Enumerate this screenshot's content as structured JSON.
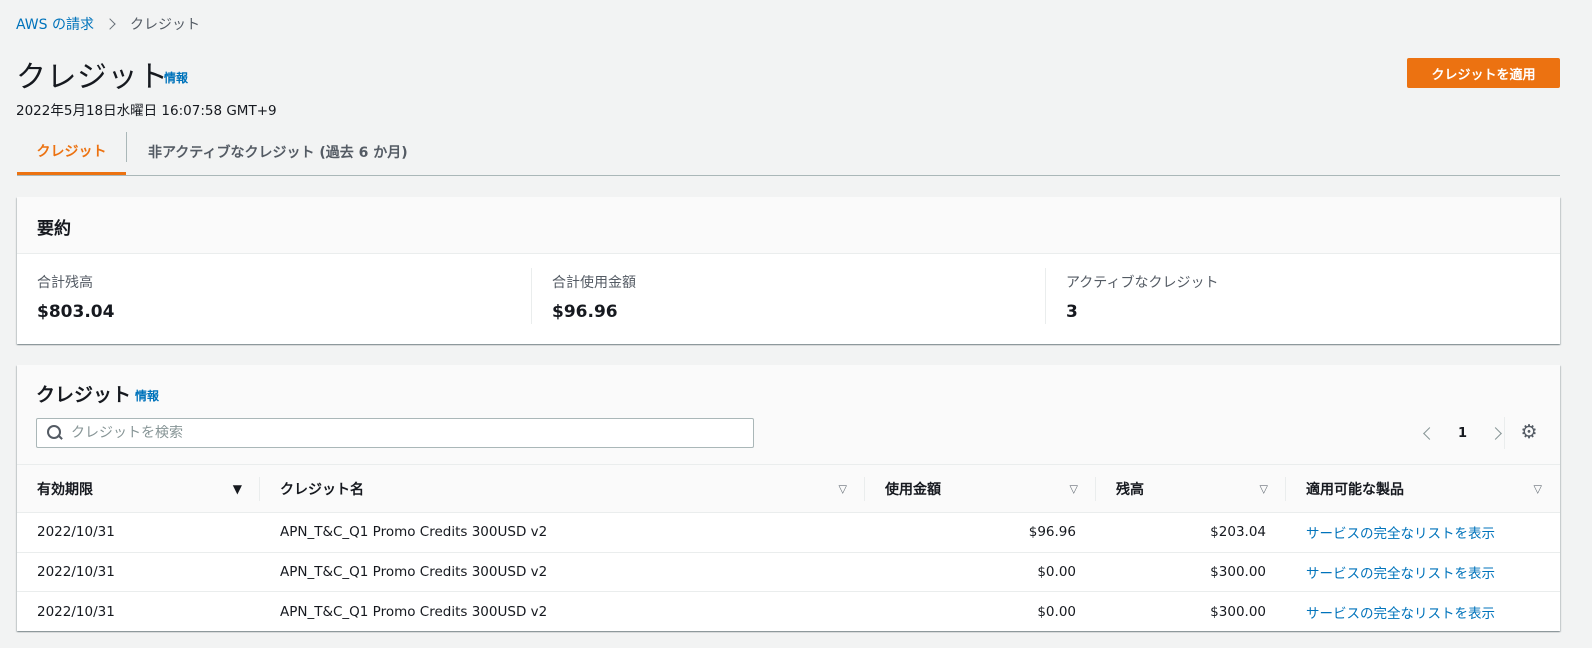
{
  "breadcrumb": {
    "parent": "AWS の請求",
    "current": "クレジット"
  },
  "page": {
    "title": "クレジット",
    "info_label": "情報",
    "timestamp": "2022年5月18日水曜日 16:07:58 GMT+9",
    "apply_button_label": "クレジットを適用"
  },
  "tabs": [
    {
      "label": "クレジット",
      "active": true
    },
    {
      "label": "非アクティブなクレジット (過去 6 か月)",
      "active": false
    }
  ],
  "summary": {
    "title": "要約",
    "items": [
      {
        "label": "合計残高",
        "value": "$803.04"
      },
      {
        "label": "合計使用金額",
        "value": "$96.96"
      },
      {
        "label": "アクティブなクレジット",
        "value": "3"
      }
    ]
  },
  "credits": {
    "title": "クレジット",
    "info_label": "情報",
    "search_placeholder": "クレジットを検索",
    "page_number": "1",
    "columns": [
      "有効期限",
      "クレジット名",
      "使用金額",
      "残高",
      "適用可能な製品"
    ],
    "rows": [
      {
        "expiry": "2022/10/31",
        "name": "APN_T&C_Q1 Promo Credits 300USD v2",
        "used": "$96.96",
        "balance": "$203.04",
        "products": "サービスの完全なリストを表示"
      },
      {
        "expiry": "2022/10/31",
        "name": "APN_T&C_Q1 Promo Credits 300USD v2",
        "used": "$0.00",
        "balance": "$300.00",
        "products": "サービスの完全なリストを表示"
      },
      {
        "expiry": "2022/10/31",
        "name": "APN_T&C_Q1 Promo Credits 300USD v2",
        "used": "$0.00",
        "balance": "$300.00",
        "products": "サービスの完全なリストを表示"
      }
    ]
  },
  "colors": {
    "accent": "#ec7211",
    "link": "#0073bb",
    "background": "#f2f3f3"
  },
  "icons": {
    "search": "search-icon",
    "settings": "gear-icon",
    "prev": "chevron-left-icon",
    "next": "chevron-right-icon",
    "breadcrumb_sep": "chevron-right-icon"
  }
}
